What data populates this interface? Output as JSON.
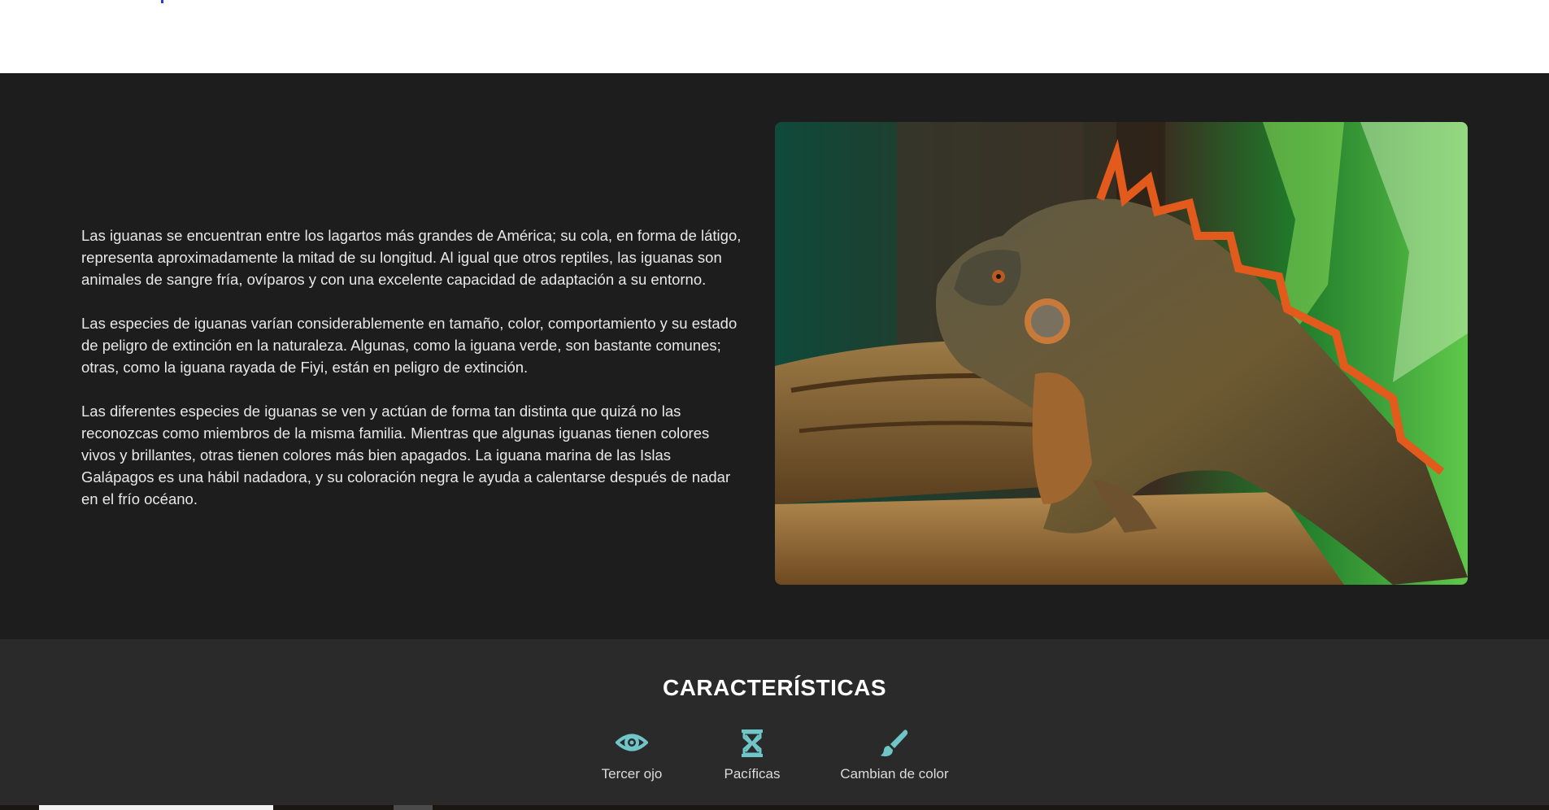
{
  "intro": {
    "paragraphs": [
      "Las iguanas se encuentran entre los lagartos más grandes de América; su cola, en forma de látigo, representa aproximadamente la mitad de su longitud. Al igual que otros reptiles, las iguanas son animales de sangre fría, ovíparos y con una excelente capacidad de adaptación a su entorno.",
      "Las especies de iguanas varían considerablemente en tamaño, color, comportamiento y su estado de peligro de extinción en la naturaleza. Algunas, como la iguana verde, son bastante comunes; otras, como la iguana rayada de Fiyi, están en peligro de extinción.",
      "Las diferentes especies de iguanas se ven y actúan de forma tan distinta que quizá no las reconozcas como miembros de la misma familia. Mientras que algunas iguanas tienen colores vivos y brillantes, otras tienen colores más bien apagados. La iguana marina de las Islas Galápagos es una hábil nadadora, y su coloración negra le ayuda a calentarse después de nadar en el frío océano."
    ]
  },
  "features": {
    "title": "CARACTERÍSTICAS",
    "icon_color": "#6fc5c8",
    "items": [
      {
        "icon": "eye-icon",
        "label": "Tercer ojo"
      },
      {
        "icon": "hourglass-icon",
        "label": "Pacíficas"
      },
      {
        "icon": "paintbrush-icon",
        "label": "Cambian de color"
      }
    ]
  },
  "colors": {
    "intro_bg": "#1d1d1d",
    "features_bg": "#2a2a2a",
    "accent": "#6fc5c8"
  }
}
